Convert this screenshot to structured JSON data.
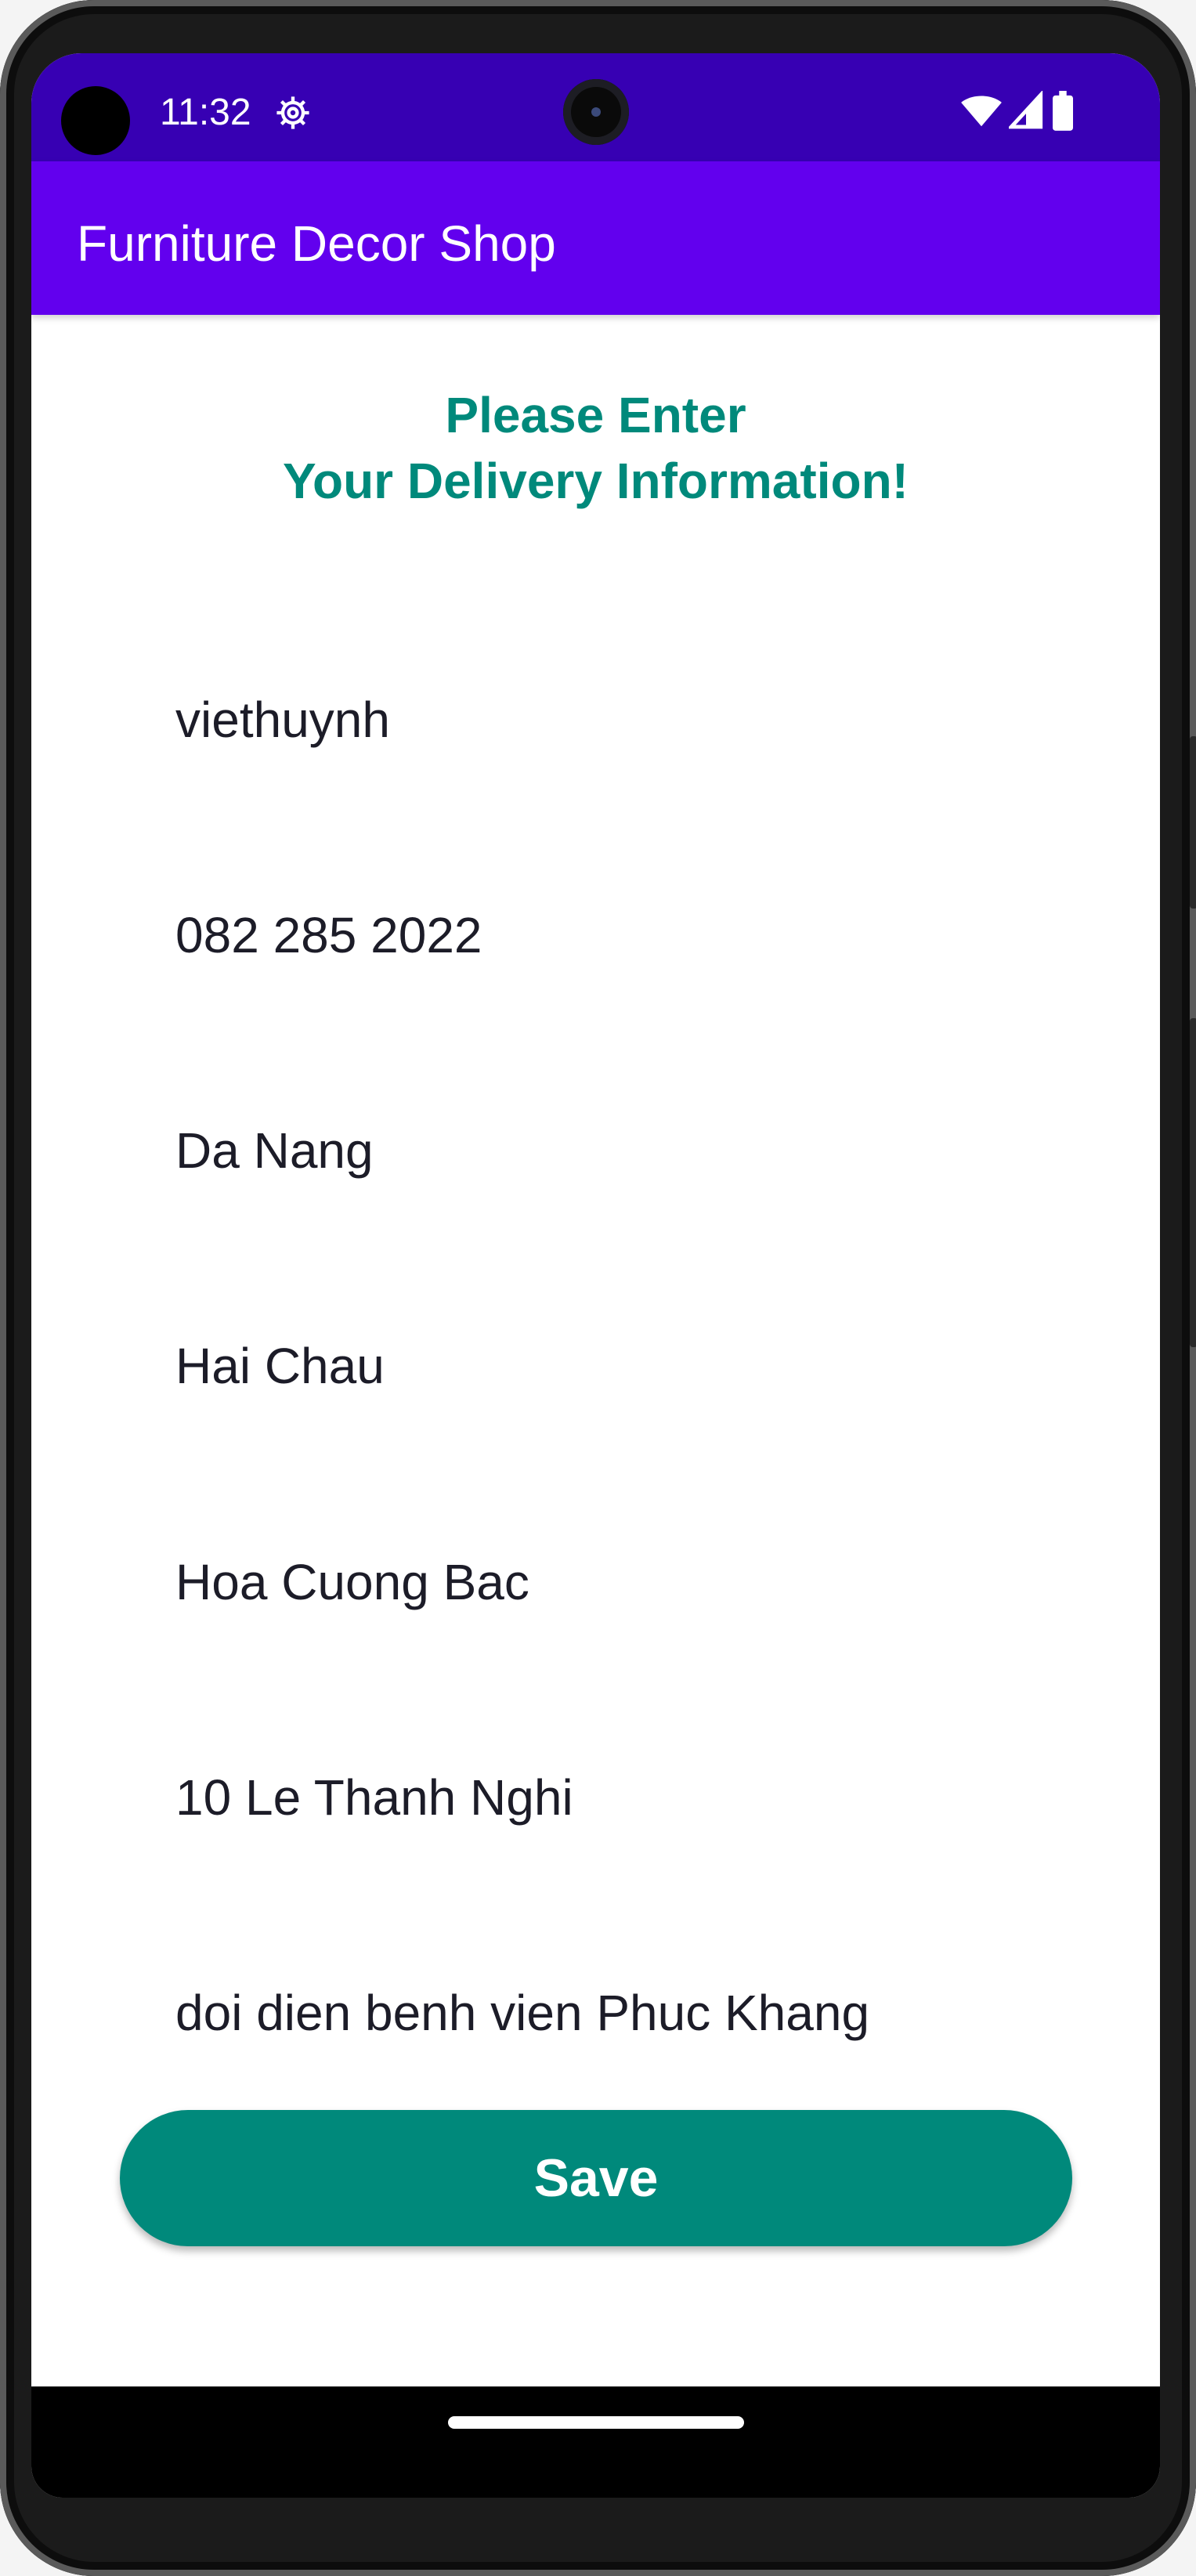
{
  "status_bar": {
    "time": "11:32",
    "icons": [
      "gear-icon",
      "wifi-icon",
      "signal-icon",
      "battery-icon"
    ]
  },
  "app_bar": {
    "title": "Furniture Decor Shop",
    "color": "#6200ee"
  },
  "heading": {
    "line1": "Please Enter",
    "line2": "Your Delivery Information!",
    "color": "#00897b"
  },
  "form": {
    "fields": [
      {
        "name": "username",
        "value": "viethuynh"
      },
      {
        "name": "phone",
        "value": "082 285 2022"
      },
      {
        "name": "city",
        "value": "Da Nang"
      },
      {
        "name": "district",
        "value": "Hai Chau"
      },
      {
        "name": "ward",
        "value": "Hoa Cuong Bac"
      },
      {
        "name": "street",
        "value": "10 Le Thanh Nghi"
      },
      {
        "name": "note",
        "value": "doi dien benh vien Phuc Khang"
      }
    ]
  },
  "save_button": {
    "label": "Save",
    "color": "#00897b"
  }
}
